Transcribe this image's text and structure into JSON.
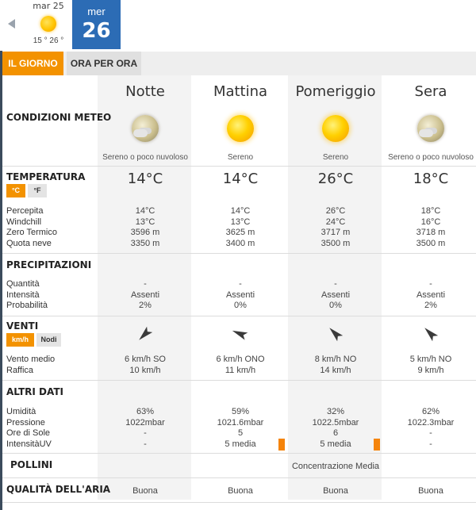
{
  "day_nav": {
    "prev": {
      "name": "mar 25",
      "temps": "15 ° 26 °",
      "icon": "sun-icon"
    },
    "current": {
      "name": "mer",
      "number": "26"
    }
  },
  "tabs": [
    {
      "label": "IL GIORNO",
      "active": true
    },
    {
      "label": "ORA PER ORA",
      "active": false
    }
  ],
  "sections": {
    "conditions": "CONDIZIONI METEO",
    "temperature": "TEMPERATURA",
    "precipitation": "PRECIPITAZIONI",
    "wind": "VENTI",
    "other": "ALTRI DATI",
    "pollen": "POLLINI",
    "air": "QUALITÀ DELL'ARIA"
  },
  "units": {
    "temp": [
      {
        "label": "°C",
        "active": true
      },
      {
        "label": "°F",
        "active": false
      }
    ],
    "wind": [
      {
        "label": "km/h",
        "active": true
      },
      {
        "label": "Nodi",
        "active": false
      }
    ]
  },
  "row_labels": {
    "temperature": [
      "Percepita",
      "Windchill",
      "Zero Termico",
      "Quota neve"
    ],
    "precipitation": [
      "Quantità",
      "Intensità",
      "Probabilità"
    ],
    "wind": [
      "Vento medio",
      "Raffica"
    ],
    "other": [
      "Umidità",
      "Pressione",
      "Ore di Sole",
      "IntensitàUV"
    ]
  },
  "periods": [
    {
      "name": "Notte",
      "icon": "moon-cloud-icon",
      "condition": "Sereno o poco nuvoloso",
      "temp": "14°C",
      "temp_rows": [
        "14°C",
        "13°C",
        "3596 m",
        "3350 m"
      ],
      "precip_rows": [
        "-",
        "Assenti",
        "2%"
      ],
      "wind_dir_deg": 225,
      "wind_icon": "wind-direction-arrow-icon",
      "wind_rows": [
        "6 km/h  SO",
        "10 km/h"
      ],
      "other_rows": [
        "63%",
        "1022mbar",
        "-",
        "-"
      ],
      "uv_level": 0,
      "air": "Buona"
    },
    {
      "name": "Mattina",
      "icon": "sun-icon",
      "condition": "Sereno",
      "temp": "14°C",
      "temp_rows": [
        "14°C",
        "13°C",
        "3625 m",
        "3400 m"
      ],
      "precip_rows": [
        "-",
        "Assenti",
        "0%"
      ],
      "wind_dir_deg": 292,
      "wind_icon": "wind-direction-arrow-icon",
      "wind_rows": [
        "6 km/h ONO",
        "11 km/h"
      ],
      "other_rows": [
        "59%",
        "1021.6mbar",
        "5",
        "5 media"
      ],
      "uv_level": 5,
      "air": "Buona"
    },
    {
      "name": "Pomeriggio",
      "icon": "sun-icon",
      "condition": "Sereno",
      "temp": "26°C",
      "temp_rows": [
        "26°C",
        "24°C",
        "3717 m",
        "3500 m"
      ],
      "precip_rows": [
        "-",
        "Assenti",
        "0%"
      ],
      "wind_dir_deg": 315,
      "wind_icon": "wind-direction-arrow-icon",
      "wind_rows": [
        "8 km/h NO",
        "14 km/h"
      ],
      "other_rows": [
        "32%",
        "1022.5mbar",
        "6",
        "5 media"
      ],
      "uv_level": 5,
      "air": "Buona"
    },
    {
      "name": "Sera",
      "icon": "moon-cloud-icon",
      "condition": "Sereno o poco nuvoloso",
      "temp": "18°C",
      "temp_rows": [
        "18°C",
        "16°C",
        "3718 m",
        "3500 m"
      ],
      "precip_rows": [
        "-",
        "Assenti",
        "2%"
      ],
      "wind_dir_deg": 315,
      "wind_icon": "wind-direction-arrow-icon",
      "wind_rows": [
        "5 km/h NO",
        "9 km/h"
      ],
      "other_rows": [
        "62%",
        "1022.3mbar",
        "-",
        "-"
      ],
      "uv_level": 0,
      "air": "Buona"
    }
  ],
  "pollen": {
    "value": "Concentrazione Media"
  },
  "colors": {
    "accent": "#f39200",
    "date_blue": "#2c6cb5",
    "uv": "#f5840b"
  }
}
